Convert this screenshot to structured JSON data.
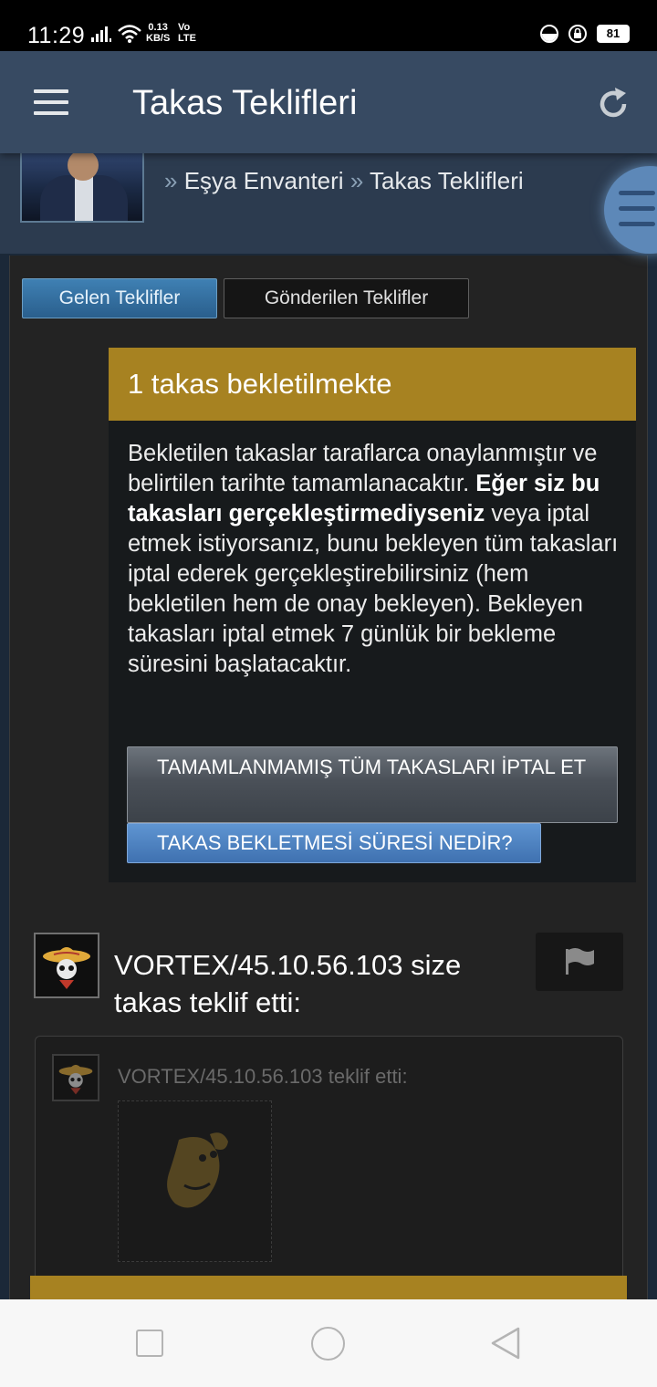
{
  "status_bar": {
    "time": "11:29",
    "speed_value": "0.13",
    "speed_unit": "KB/S",
    "volte_top": "Vo",
    "volte_bottom": "LTE",
    "battery": "81"
  },
  "header": {
    "title": "Takas Teklifleri",
    "menu_icon": "hamburger-icon",
    "refresh_icon": "refresh-icon"
  },
  "breadcrumb": {
    "separator": "»",
    "items": [
      "Eşya Envanteri",
      "Takas Teklifleri"
    ]
  },
  "tabs": {
    "incoming": "Gelen Teklifler",
    "sent": "Gönderilen Teklifler"
  },
  "notice": {
    "title": "1 takas bekletilmekte",
    "text_part1": "Bekletilen takaslar taraflarca onaylanmıştır ve belirtilen tarihte tamamlanacaktır. ",
    "text_bold": "Eğer siz bu takasları gerçekleştirmediyseniz",
    "text_part2": " veya iptal etmek istiyorsanız, bunu bekleyen tüm takasları iptal ederek gerçekleştirebilirsiniz (hem bekletilen hem de onay bekleyen). Bekleyen takasları iptal etmek 7 günlük bir bekleme süresini başlatacaktır.",
    "cancel_button": "TAMAMLANMAMIŞ TÜM TAKASLARI İPTAL ET",
    "info_button": "TAKAS BEKLETMESİ SÜRESİ NEDİR?"
  },
  "trade": {
    "title": "VORTEX/45.10.56.103 size takas teklif etti:",
    "offer_label": "VORTEX/45.10.56.103 teklif etti:",
    "flag_icon": "flag-icon"
  },
  "colors": {
    "accent_gold": "#a78221",
    "header_bg": "#374a62",
    "tab_active": "#3f80b3",
    "info_button": "#5f95d2"
  }
}
